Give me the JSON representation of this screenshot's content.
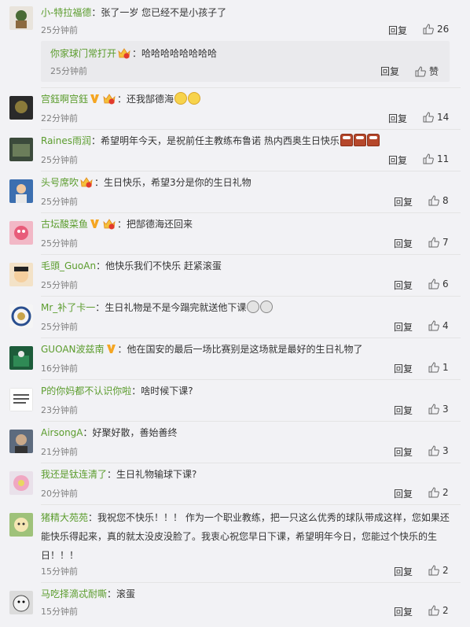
{
  "labels": {
    "reply": "回复",
    "like": "赞"
  },
  "comments": [
    {
      "user": "小-特拉福德",
      "sep": "：",
      "text": "张了一岁 您已经不是小孩子了",
      "time": "25分钟前",
      "likes": "26"
    },
    {
      "user": "宫鈺啊宫鈺",
      "sep": "：",
      "text": "还我郜德海",
      "time": "22分钟前",
      "likes": "14"
    },
    {
      "user": "Raines雨润",
      "sep": "：",
      "text": "希望明年今天，是祝前任主教练布鲁诺 热内西奥生日快乐",
      "time": "25分钟前",
      "likes": "11"
    },
    {
      "user": "头号席吹",
      "sep": "：",
      "text": "生日快乐，希望3分是你的生日礼物",
      "time": "25分钟前",
      "likes": "8"
    },
    {
      "user": "古坛酸菜鱼",
      "sep": "：",
      "text": "把郜德海还回来",
      "time": "25分钟前",
      "likes": "7"
    },
    {
      "user": "毛頭_GuoAn",
      "sep": "：",
      "text": "他快乐我们不快乐 赶紧滚蛋",
      "time": "25分钟前",
      "likes": "6"
    },
    {
      "user": "Mr_补了卡一",
      "sep": "：",
      "text": "生日礼物是不是今蹋完就送他下课",
      "time": "25分钟前",
      "likes": "4"
    },
    {
      "user": "GUOAN波兹南",
      "sep": "：",
      "text": "他在国安的最后一场比赛别是这场就是最好的生日礼物了",
      "time": "16分钟前",
      "likes": "1"
    },
    {
      "user": "P的你妈都不认识你啦",
      "sep": "：",
      "text": "啥时候下课?",
      "time": "23分钟前",
      "likes": "3"
    },
    {
      "user": "AirsongA",
      "sep": "：",
      "text": "好聚好散，善始善终",
      "time": "21分钟前",
      "likes": "3"
    },
    {
      "user": "我还是钛连清了",
      "sep": "：",
      "text": "生日礼物输球下课?",
      "time": "20分钟前",
      "likes": "2"
    },
    {
      "user": "猪精大苑苑",
      "sep": "：",
      "text": "我祝您不快乐！！！ 作为一个职业教练，把一只这么优秀的球队带成这样，您如果还能快乐得起来，真的就太没皮没脸了。我衷心祝您早日下课，希望明年今日，您能过个快乐的生日！！！",
      "time": "15分钟前",
      "likes": "2"
    },
    {
      "user": "马吃择滴忒耐嘶",
      "sep": "：",
      "text": "滚蛋",
      "time": "15分钟前",
      "likes": "2"
    }
  ],
  "nested_reply": {
    "user": "你家球门常打开",
    "sep": "：",
    "text": "哈哈哈哈哈哈哈哈",
    "time": "25分钟前"
  },
  "colors": {
    "username": "#5b9c2d",
    "background": "#f2f2f5",
    "nested_bg": "#eaeaed",
    "text": "#333333",
    "time": "#808080"
  }
}
